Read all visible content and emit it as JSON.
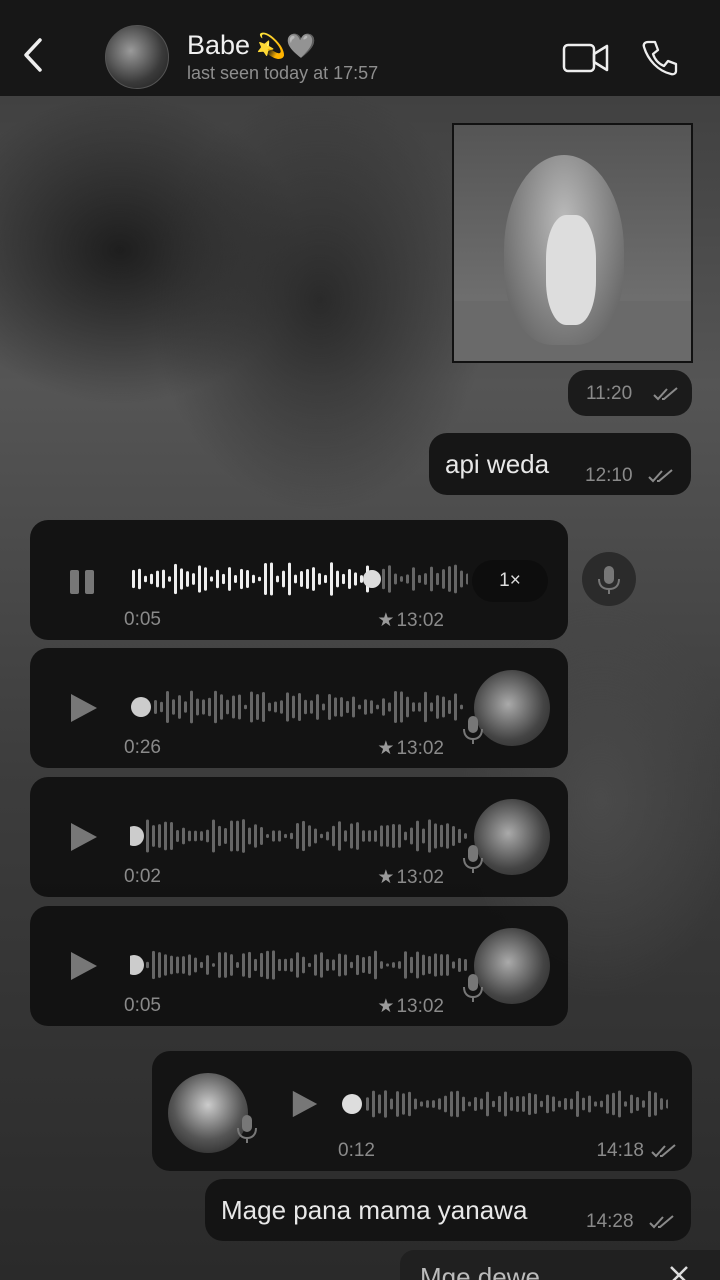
{
  "header": {
    "contact_name": "Babe",
    "name_emojis": "💫🩶",
    "last_seen": "last seen today at 17:57"
  },
  "messages": [
    {
      "type": "image",
      "time": "11:20",
      "direction": "outgoing",
      "read": true
    },
    {
      "type": "text",
      "text": "api weda",
      "time": "12:10",
      "direction": "outgoing",
      "read": true
    },
    {
      "type": "voice",
      "duration": "0:05",
      "time": "13:02",
      "starred": true,
      "playing": true,
      "speed": "1×",
      "direction": "incoming"
    },
    {
      "type": "voice",
      "duration": "0:26",
      "time": "13:02",
      "starred": true,
      "direction": "incoming"
    },
    {
      "type": "voice",
      "duration": "0:02",
      "time": "13:02",
      "starred": true,
      "direction": "incoming"
    },
    {
      "type": "voice",
      "duration": "0:05",
      "time": "13:02",
      "starred": true,
      "direction": "incoming"
    },
    {
      "type": "voice",
      "duration": "0:12",
      "time": "14:18",
      "direction": "outgoing",
      "read": true
    },
    {
      "type": "text",
      "text": "Mage pana mama yanawa",
      "time": "14:28",
      "direction": "outgoing",
      "read": true
    }
  ],
  "reply_preview": {
    "text": "Mge dewe"
  },
  "icons": [
    "back-icon",
    "video-icon",
    "phone-icon",
    "mic-icon",
    "play-icon",
    "pause-icon",
    "star-icon",
    "double-check-icon",
    "close-icon"
  ],
  "colors": {
    "bubble": "#181818",
    "meta_text": "#8a8a8a",
    "text": "#e8e8e8"
  }
}
